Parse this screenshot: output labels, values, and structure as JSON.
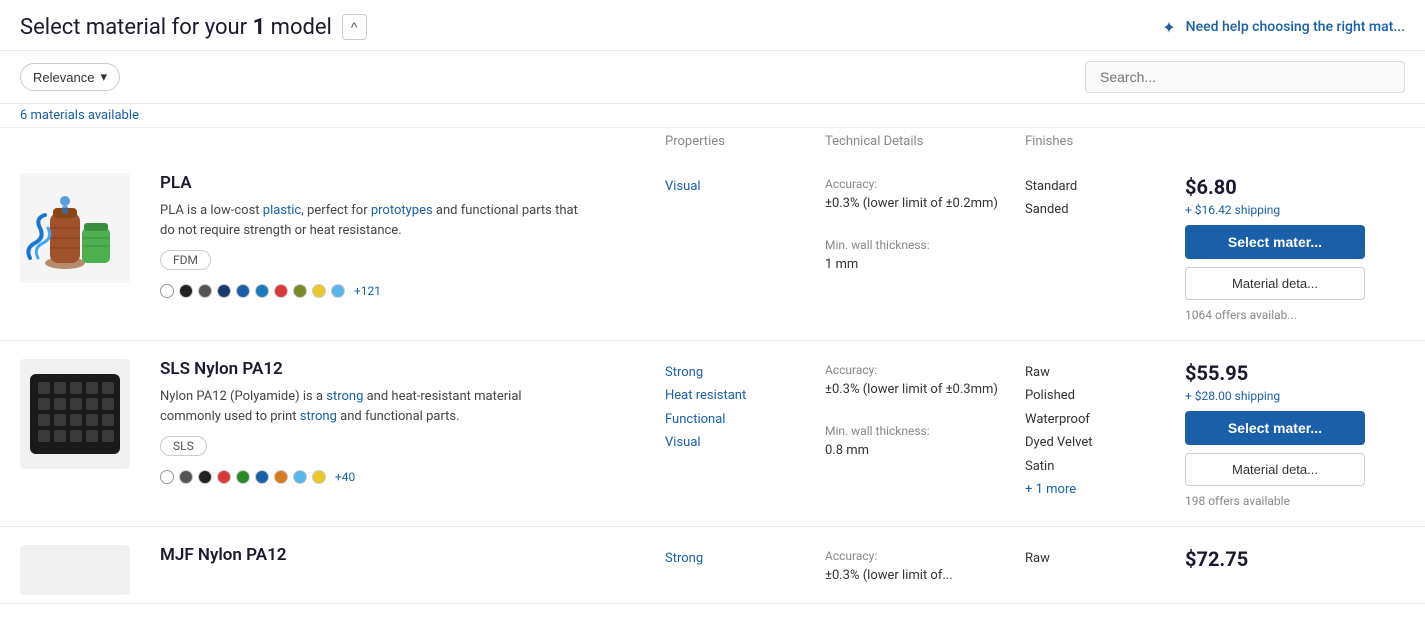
{
  "header": {
    "title_prefix": "Select material for your ",
    "model_count": "1",
    "title_suffix": " model",
    "collapse_label": "^",
    "help_text": "Need help choosing the right mat..."
  },
  "filter": {
    "sort_label": "Relevance",
    "search_placeholder": "Search..."
  },
  "table": {
    "materials_count": "6 materials available",
    "col_properties": "Properties",
    "col_technical": "Technical Details",
    "col_finishes": "Finishes"
  },
  "materials": [
    {
      "id": "pla",
      "name": "PLA",
      "description": "PLA is a low-cost plastic, perfect for prototypes and functional parts that do not require strength or heat resistance.",
      "tag": "FDM",
      "properties": [
        "Visual"
      ],
      "accuracy_label": "Accuracy:",
      "accuracy_value": "±0.3% (lower limit of ±0.2mm)",
      "wall_label": "Min. wall thickness:",
      "wall_value": "1 mm",
      "finishes": [
        "Standard",
        "Sanded"
      ],
      "price": "$6.80",
      "shipping": "+ $16.42 shipping",
      "btn_select": "Select mater...",
      "btn_details": "Material deta...",
      "offers": "1064 offers availab...",
      "colors_extra": "+121"
    },
    {
      "id": "sls-nylon",
      "name": "SLS Nylon PA12",
      "description": "Nylon PA12 (Polyamide) is a strong and heat-resistant material commonly used to print strong and functional parts.",
      "tag": "SLS",
      "properties": [
        "Strong",
        "Heat resistant",
        "Functional",
        "Visual"
      ],
      "accuracy_label": "Accuracy:",
      "accuracy_value": "±0.3% (lower limit of ±0.3mm)",
      "wall_label": "Min. wall thickness:",
      "wall_value": "0.8 mm",
      "finishes": [
        "Raw",
        "Polished",
        "Waterproof",
        "Dyed Velvet",
        "Satin"
      ],
      "finishes_more": "+ 1 more",
      "price": "$55.95",
      "shipping": "+ $28.00 shipping",
      "btn_select": "Select mater...",
      "btn_details": "Material deta...",
      "offers": "198 offers available",
      "colors_extra": "+40"
    },
    {
      "id": "mjf-nylon",
      "name": "MJF Nylon PA12",
      "description": "",
      "tag": "",
      "properties": [
        "Strong"
      ],
      "accuracy_label": "Accuracy:",
      "accuracy_value": "±0.3% (lower limit of...",
      "wall_label": "",
      "wall_value": "",
      "finishes": [
        "Raw"
      ],
      "price": "$72.75",
      "shipping": "",
      "btn_select": "",
      "btn_details": "",
      "offers": "",
      "colors_extra": ""
    }
  ]
}
